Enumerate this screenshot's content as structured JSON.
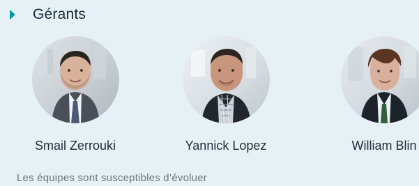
{
  "section": {
    "title": "Gérants"
  },
  "team": [
    {
      "name": "Smail Zerrouki"
    },
    {
      "name": "Yannick Lopez"
    },
    {
      "name": "William Blin"
    }
  ],
  "disclaimer": "Les équipes sont susceptibles d’évoluer",
  "colors": {
    "panel_background": "#e6f1f6",
    "accent": "#0097b2",
    "title_text": "#142c3a",
    "name_text": "#1d2b35",
    "disclaimer_text": "#6b747c"
  }
}
